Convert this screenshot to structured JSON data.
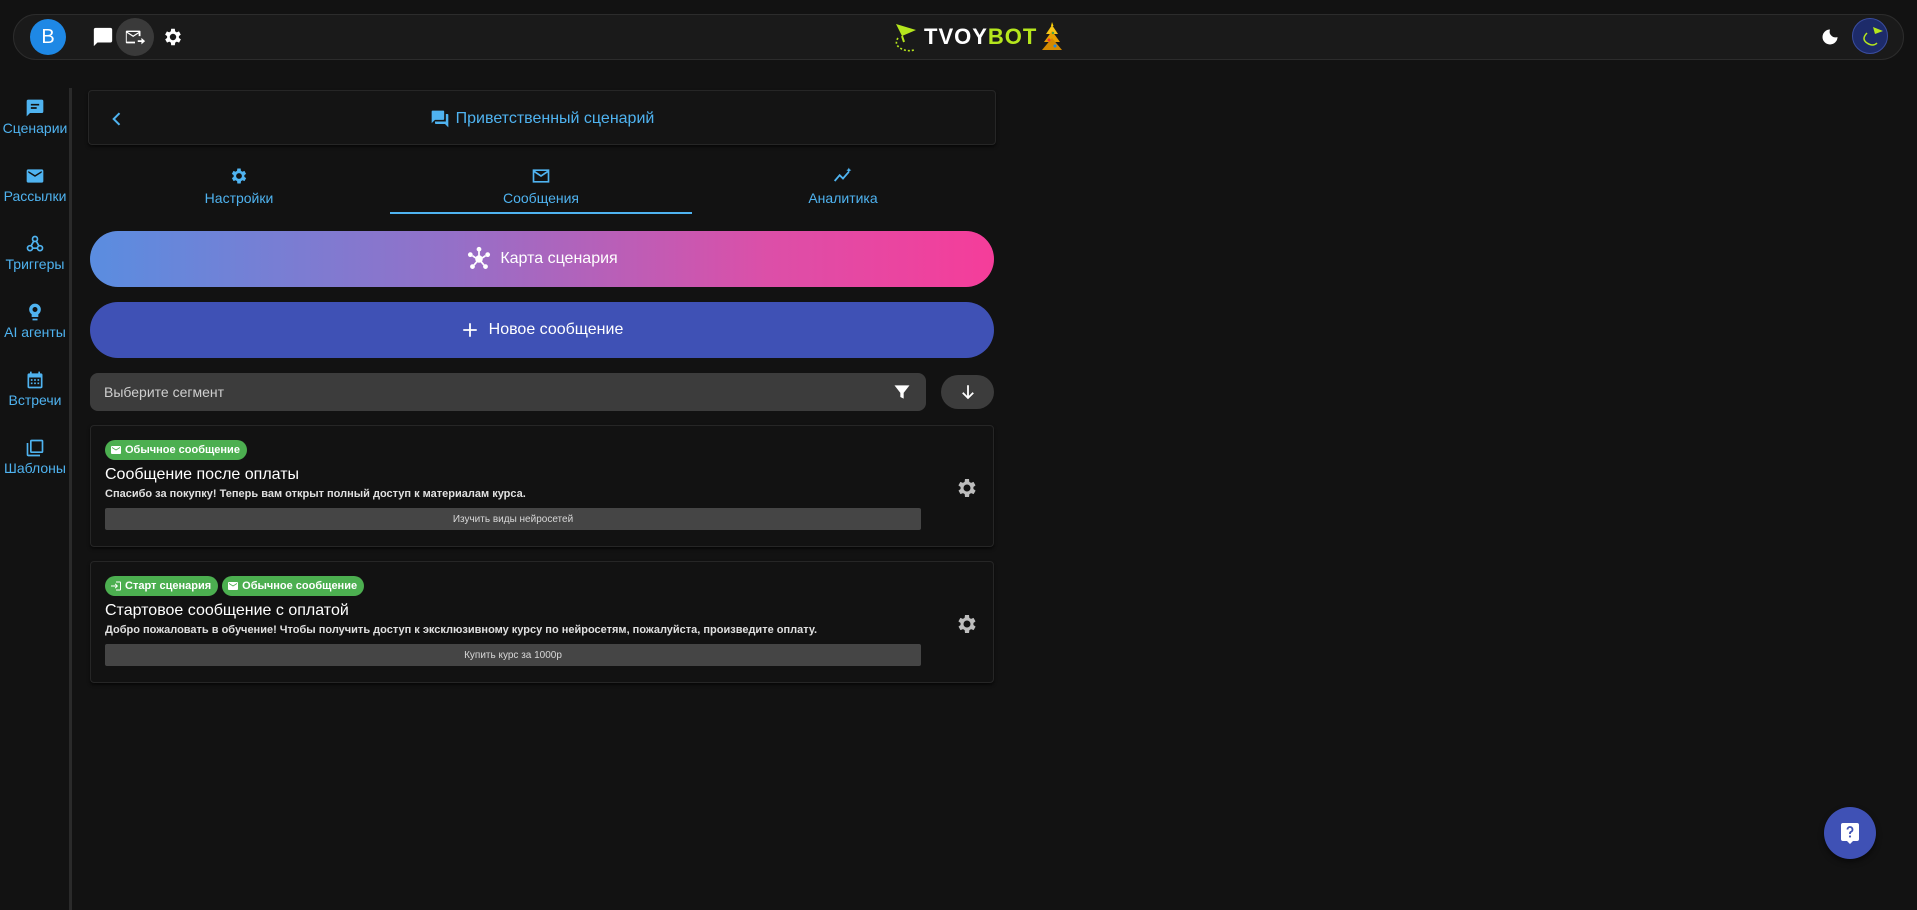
{
  "topbar": {
    "avatar_letter": "B",
    "logo_part1": "TVOY",
    "logo_part2": "BOT",
    "icons": [
      "chat-icon",
      "mail-send-icon",
      "gear-icon",
      "moon-icon",
      "user-avatar"
    ]
  },
  "sidebar": {
    "items": [
      {
        "label": "Сценарии",
        "icon": "scenario-icon"
      },
      {
        "label": "Рассылки",
        "icon": "mail-icon"
      },
      {
        "label": "Триггеры",
        "icon": "webhook-icon"
      },
      {
        "label": "AI агенты",
        "icon": "ai-agent-icon"
      },
      {
        "label": "Встречи",
        "icon": "calendar-icon"
      },
      {
        "label": "Шаблоны",
        "icon": "templates-icon"
      }
    ]
  },
  "header": {
    "title": "Приветственный сценарий"
  },
  "tabs": [
    {
      "label": "Настройки",
      "icon": "gear-icon"
    },
    {
      "label": "Сообщения",
      "icon": "mail-icon",
      "active": true
    },
    {
      "label": "Аналитика",
      "icon": "analytics-icon"
    }
  ],
  "actions": {
    "map_label": "Карта сценария",
    "new_label": "Новое сообщение"
  },
  "segment": {
    "placeholder": "Выберите сегмент"
  },
  "messages": [
    {
      "badges": [
        {
          "label": "Обычное сообщение",
          "icon": "mail-icon"
        }
      ],
      "title": "Сообщение после оплаты",
      "text": "Спасибо за покупку! Теперь вам открыт полный доступ к материалам курса.",
      "button": "Изучить виды нейросетей"
    },
    {
      "badges": [
        {
          "label": "Старт сценария",
          "icon": "login-icon"
        },
        {
          "label": "Обычное сообщение",
          "icon": "mail-icon"
        }
      ],
      "title": "Стартовое сообщение с оплатой",
      "text": "Добро пожаловать в обучение! Чтобы получить доступ к эксклюзивному курсу по нейросетям, пожалуйста, произведите оплату.",
      "button": "Купить курс за 1000р"
    }
  ],
  "colors": {
    "accent": "#4fb3f0",
    "primary": "#3f51b5",
    "badge": "#4caf50",
    "background": "#121212"
  }
}
